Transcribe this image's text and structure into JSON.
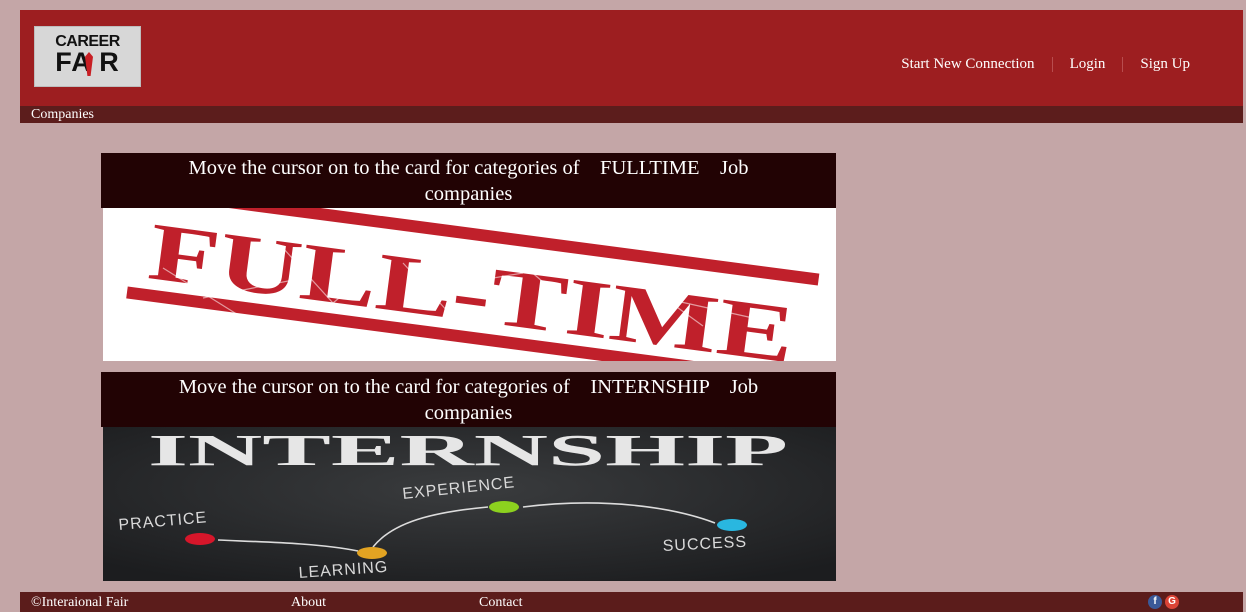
{
  "header": {
    "logo": {
      "line1": "CAREER",
      "line2": "FA  R"
    },
    "nav": [
      {
        "label": "Start New Connection"
      },
      {
        "label": "Login"
      },
      {
        "label": "Sign Up"
      }
    ]
  },
  "subnav": {
    "label": "Companies"
  },
  "cards": [
    {
      "heading_line1": "Move the cursor on to the card for categories of    FULLTIME    Job",
      "heading_line2": "companies",
      "image_text": "FULL-TIME"
    },
    {
      "heading_line1": "Move the cursor on to the card for categories of    INTERNSHIP    Job",
      "heading_line2": "companies",
      "image_title": "INTERNSHIP",
      "image_steps": [
        "PRACTICE",
        "LEARNING",
        "EXPERIENCE",
        "SUCCESS"
      ]
    }
  ],
  "footer": {
    "copyright": "©Interaional Fair",
    "about": "About",
    "contact": "Contact",
    "icons": [
      "facebook-icon",
      "google-icon"
    ]
  },
  "colors": {
    "page_bg": "#c4a6a7",
    "header_bg": "#9d1e20",
    "subbar_bg": "#5c1d1c",
    "card_head_bg": "#220304",
    "stamp_red": "#c0202b"
  }
}
